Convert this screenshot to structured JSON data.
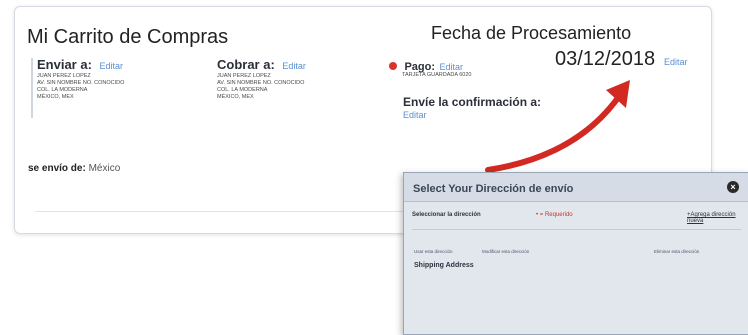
{
  "cart": {
    "title": "Mi Carrito de Compras",
    "processing_title": "Fecha de Procesamiento",
    "processing_date": "03/12/2018",
    "edit_label": "Editar",
    "ship_to": {
      "label": "Enviar a:",
      "edit": "Editar",
      "lines": [
        "JUAN PEREZ LOPEZ",
        "AV. SIN NOMBRE No. CONOCIDO",
        "COL. LA MODERNA",
        "MÉXICO, MEX"
      ]
    },
    "bill_to": {
      "label": "Cobrar a:",
      "edit": "Editar",
      "lines": [
        "JUAN PEREZ LOPEZ",
        "AV. SIN NOMBRE No. CONOCIDO",
        "COL. LA MODERNA",
        "MÉXICO, MEX"
      ]
    },
    "payment": {
      "label": "Pago:",
      "edit": "Editar",
      "detail": "TARJETA GUARDADA 6020"
    },
    "confirmation": {
      "label": "Envíe la confirmación a:",
      "edit": "Editar"
    },
    "shipped_from": {
      "label": "se envío de:",
      "value": "México"
    }
  },
  "modal": {
    "title": "Select Your Dirección de envío",
    "close": "×",
    "select_label": "Seleccionar la dirección",
    "required": "• = Requerido",
    "add_address": "+Agrega dirección nueva",
    "use_address": "Usar esta dirección",
    "edit_address": "Modificar esta dirección",
    "delete_address": "Eliminar esta dirección",
    "shipping_address": "Shipping Address"
  },
  "colors": {
    "accent_link": "#5a8fd0",
    "arrow_red": "#d22a22",
    "status_dot": "#d9342b"
  }
}
